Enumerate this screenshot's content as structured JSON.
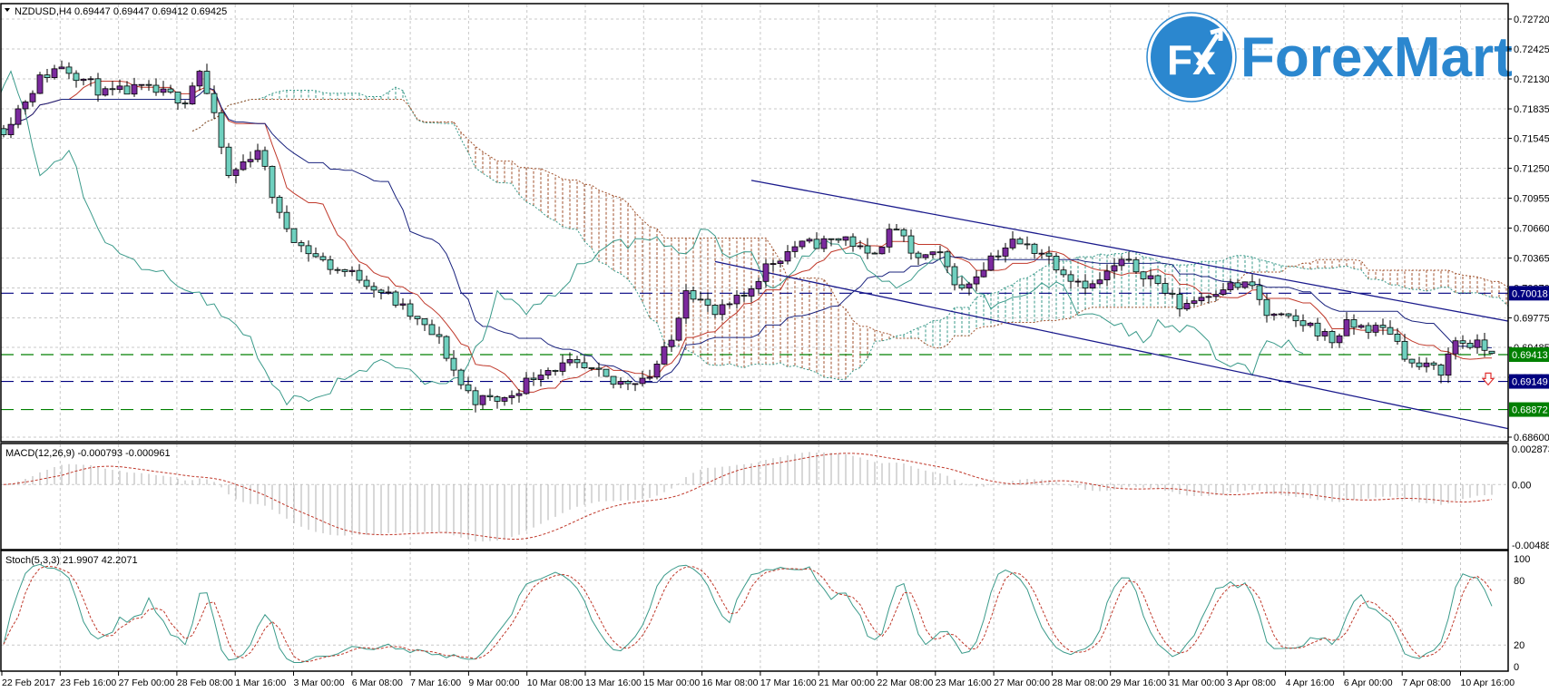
{
  "chart_data": {
    "type": "candlestick",
    "header": "NZDUSD,H4  0.69447 0.69447 0.69412 0.69425",
    "symbol": "NZDUSD",
    "timeframe": "H4",
    "ohlc": {
      "open": 0.69447,
      "high": 0.69447,
      "low": 0.69412,
      "close": 0.69425
    },
    "logo": {
      "badge": "Fx",
      "text": "ForexMart",
      "color": "#2b87cf"
    },
    "colors": {
      "bull": "#7b2a9e",
      "bear": "#6fd0bf",
      "tenkan": "#c0392b",
      "kijun": "#1a237e",
      "chikou": "#3a9a8a",
      "cloud_up": "#3a9a8a",
      "cloud_down": "#a0522d",
      "channel": "#1a1a8c"
    },
    "price_axis": {
      "ylim": [
        0.686,
        0.7272
      ],
      "ticks": [
        "0.72720",
        "0.72425",
        "0.72130",
        "0.71835",
        "0.71545",
        "0.71250",
        "0.70955",
        "0.70660",
        "0.70365",
        "0.70070",
        "0.69775",
        "0.69485",
        "0.69190",
        "0.68600"
      ]
    },
    "time_labels": [
      "22 Feb 2017",
      "23 Feb 16:00",
      "27 Feb 00:00",
      "28 Feb 08:00",
      "1 Mar 16:00",
      "3 Mar 00:00",
      "6 Mar 08:00",
      "7 Mar 16:00",
      "9 Mar 00:00",
      "10 Mar 08:00",
      "13 Mar 16:00",
      "15 Mar 00:00",
      "16 Mar 08:00",
      "17 Mar 16:00",
      "21 Mar 00:00",
      "22 Mar 08:00",
      "23 Mar 16:00",
      "27 Mar 00:00",
      "28 Mar 08:00",
      "29 Mar 16:00",
      "31 Mar 00:00",
      "3 Apr 08:00",
      "4 Apr 16:00",
      "6 Apr 00:00",
      "7 Apr 08:00",
      "10 Apr 16:00"
    ],
    "bars_count": 206,
    "close_path": [
      [
        0,
        0.7164
      ],
      [
        3,
        0.7193
      ],
      [
        5,
        0.7213
      ],
      [
        8,
        0.7227
      ],
      [
        14,
        0.7198
      ],
      [
        19,
        0.7203
      ],
      [
        25,
        0.7193
      ],
      [
        27,
        0.7222
      ],
      [
        29,
        0.7174
      ],
      [
        31,
        0.7116
      ],
      [
        35,
        0.7145
      ],
      [
        38,
        0.7077
      ],
      [
        41,
        0.7048
      ],
      [
        45,
        0.7028
      ],
      [
        49,
        0.7018
      ],
      [
        53,
        0.6999
      ],
      [
        56,
        0.698
      ],
      [
        60,
        0.6955
      ],
      [
        63,
        0.6912
      ],
      [
        65,
        0.6897
      ],
      [
        69,
        0.6897
      ],
      [
        74,
        0.6926
      ],
      [
        78,
        0.6931
      ],
      [
        82,
        0.6921
      ],
      [
        84,
        0.6912
      ],
      [
        89,
        0.6921
      ],
      [
        92,
        0.6955
      ],
      [
        94,
        0.7009
      ],
      [
        98,
        0.698
      ],
      [
        102,
        0.6999
      ],
      [
        105,
        0.7028
      ],
      [
        109,
        0.7048
      ],
      [
        113,
        0.7052
      ],
      [
        116,
        0.7057
      ],
      [
        119,
        0.7038
      ],
      [
        123,
        0.7067
      ],
      [
        125,
        0.7038
      ],
      [
        129,
        0.7038
      ],
      [
        132,
        0.7004
      ],
      [
        136,
        0.7038
      ],
      [
        139,
        0.7052
      ],
      [
        143,
        0.7043
      ],
      [
        147,
        0.7018
      ],
      [
        150,
        0.7009
      ],
      [
        154,
        0.7033
      ],
      [
        158,
        0.7018
      ],
      [
        162,
        0.6989
      ],
      [
        168,
        0.7009
      ],
      [
        172,
        0.7009
      ],
      [
        174,
        0.698
      ],
      [
        180,
        0.697
      ],
      [
        183,
        0.6955
      ],
      [
        185,
        0.697
      ],
      [
        191,
        0.6965
      ],
      [
        194,
        0.6931
      ],
      [
        198,
        0.6926
      ],
      [
        200,
        0.6955
      ],
      [
        203,
        0.695
      ],
      [
        205,
        0.69425
      ]
    ],
    "levels": [
      {
        "price": 0.70018,
        "label": "0.70018",
        "color": "#000080"
      },
      {
        "price": 0.69413,
        "label": "0.69413",
        "color": "#008000"
      },
      {
        "price": 0.69149,
        "label": "0.69149",
        "color": "#000080"
      },
      {
        "price": 0.68872,
        "label": "0.68872",
        "color": "#008000"
      }
    ],
    "channel": [
      {
        "name": "upper",
        "from": [
          103,
          0.7113
        ],
        "to": [
          207.5,
          0.6974
        ]
      },
      {
        "name": "lower",
        "from": [
          98,
          0.7033
        ],
        "to": [
          207.5,
          0.6868
        ]
      }
    ],
    "sell_signal": {
      "bar": 204.5,
      "price": 0.6916
    },
    "ichimoku": {
      "tenkan": 9,
      "kijun": 26,
      "senkou": 52
    },
    "macd": {
      "label": "MACD(12,26,9) -0.000793 -0.000961",
      "fast": 12,
      "slow": 26,
      "signal": 9,
      "ylim": [
        -0.004881,
        0.002873
      ],
      "ticks": [
        "0.002873",
        "0.00",
        "-0.004881"
      ]
    },
    "stoch": {
      "label": "Stoch(5,3,3) 21.9907 42.2071",
      "k": 5,
      "d": 3,
      "slowing": 3,
      "ylim": [
        0,
        100
      ],
      "ticks": [
        "100",
        "80",
        "20",
        "0"
      ]
    }
  }
}
